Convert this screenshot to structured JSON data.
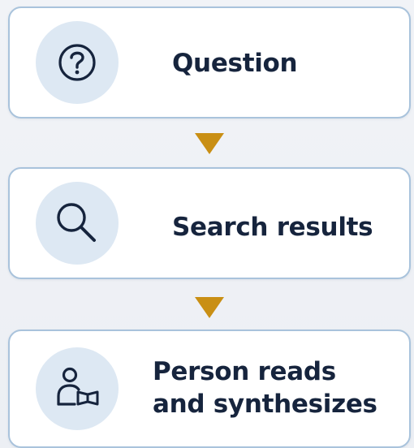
{
  "steps": [
    {
      "label": "Question",
      "icon": "question-icon"
    },
    {
      "label": "Search results",
      "icon": "search-icon"
    },
    {
      "label": "Person reads and synthesizes",
      "icon": "person-reading-icon"
    }
  ],
  "colors": {
    "arrow": "#c98f14",
    "border": "#a9c3dc",
    "icon_bg": "#dde8f3",
    "text": "#16243d"
  }
}
